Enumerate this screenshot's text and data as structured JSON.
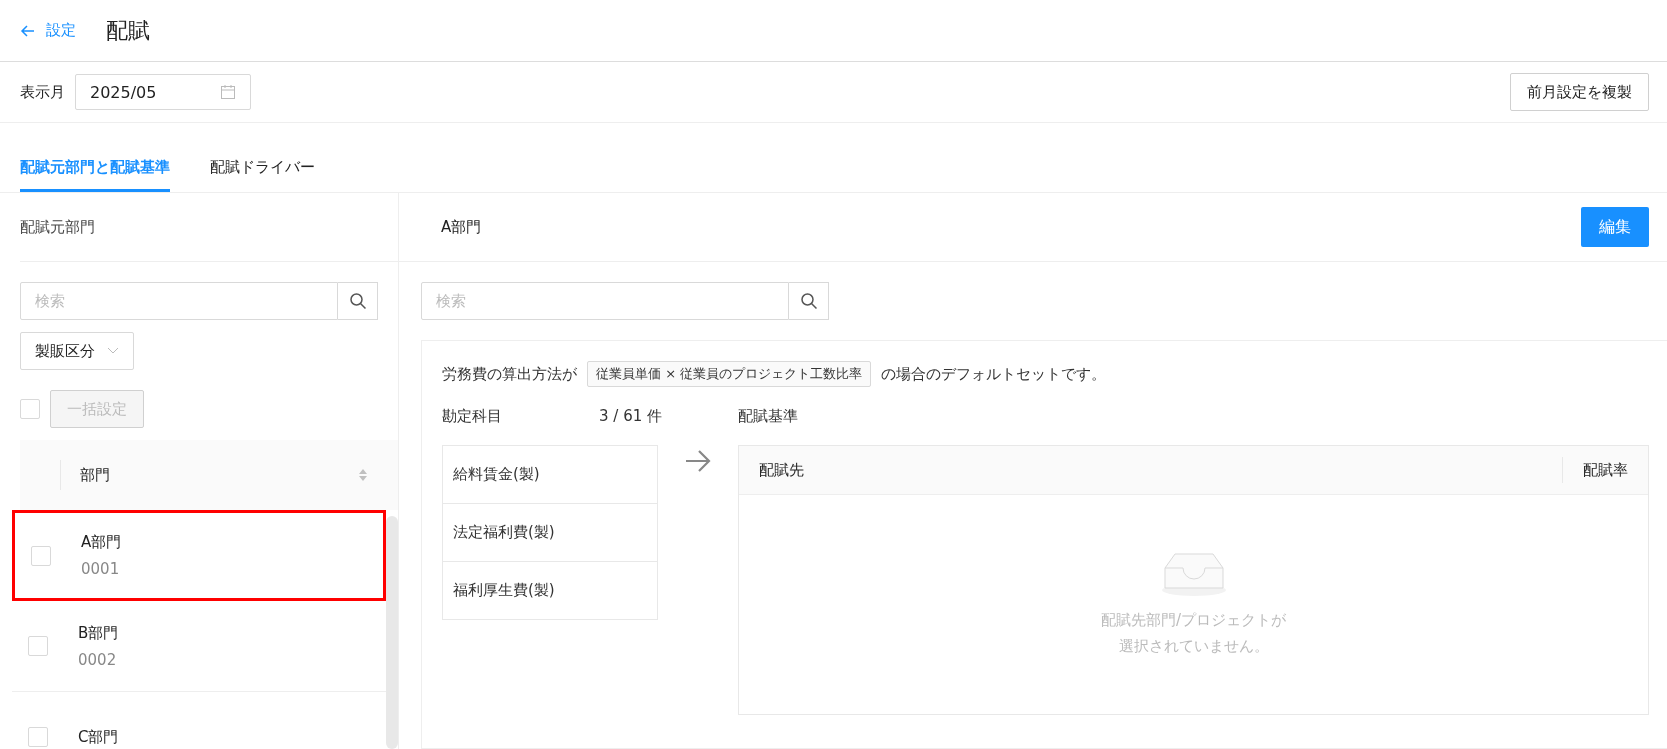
{
  "header": {
    "back_link": "設定",
    "title": "配賦"
  },
  "toolbar": {
    "month_label": "表示月",
    "month_value": "2025/05",
    "copy_button": "前月設定を複製"
  },
  "tabs": [
    {
      "label": "配賦元部門と配賦基準",
      "selected": true
    },
    {
      "label": "配賦ドライバー",
      "selected": false
    }
  ],
  "left_panel": {
    "title": "配賦元部門",
    "search": {
      "placeholder": "検索"
    },
    "filter": "製販区分",
    "bulk_checked": false,
    "bulk_button": "一括設定",
    "table": {
      "column": "部門",
      "rows": [
        {
          "name": "A部門",
          "code": "0001",
          "checked": false,
          "highlighted": true
        },
        {
          "name": "B部門",
          "code": "0002",
          "checked": false,
          "highlighted": false
        },
        {
          "name": "C部門",
          "checked": false,
          "highlighted": false
        }
      ]
    }
  },
  "right_panel": {
    "title": "A部門",
    "edit_button": "編集",
    "search": {
      "placeholder": "検索"
    },
    "note": {
      "before": "労務費の算出方法が",
      "tag": "従業員単価 × 従業員のプロジェクト工数比率",
      "after": "の場合のデフォルトセットです。"
    },
    "accounts": {
      "label": "勘定科目",
      "count": "3 / 61 件",
      "items": [
        "給料賃金(製)",
        "法定福利費(製)",
        "福利厚生費(製)"
      ]
    },
    "criteria": {
      "label": "配賦基準",
      "columns": [
        "配賦先",
        "配賦率"
      ],
      "empty_lines": [
        "配賦先部門/プロジェクトが",
        "選択されていません。"
      ]
    }
  }
}
